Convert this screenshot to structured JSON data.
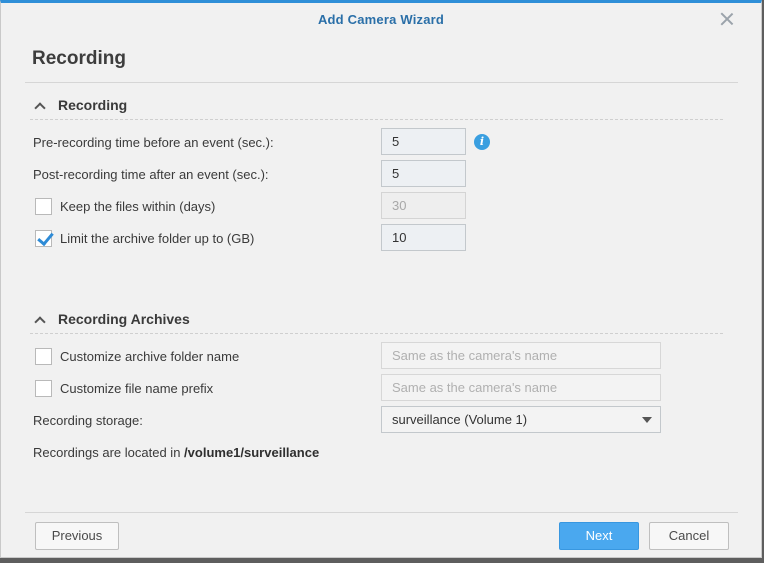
{
  "window": {
    "title": "Add Camera Wizard"
  },
  "page_title": "Recording",
  "sections": {
    "recording": {
      "heading": "Recording",
      "pre_recording": {
        "label": "Pre-recording time before an event (sec.):",
        "value": "5"
      },
      "post_recording": {
        "label": "Post-recording time after an event (sec.):",
        "value": "5"
      },
      "keep_files": {
        "label": "Keep the files within (days)",
        "checked": false,
        "value": "30"
      },
      "limit_archive": {
        "label": "Limit the archive folder up to (GB)",
        "checked": true,
        "value": "10"
      }
    },
    "archives": {
      "heading": "Recording Archives",
      "custom_folder": {
        "label": "Customize archive folder name",
        "checked": false,
        "placeholder": "Same as the camera's name"
      },
      "custom_prefix": {
        "label": "Customize file name prefix",
        "checked": false,
        "placeholder": "Same as the camera's name"
      },
      "storage": {
        "label": "Recording storage:",
        "selected": "surveillance (Volume 1)"
      },
      "location": {
        "prefix": "Recordings are located in",
        "path": "/volume1/surveillance"
      }
    }
  },
  "footer": {
    "previous": "Previous",
    "next": "Next",
    "cancel": "Cancel"
  },
  "icons": {
    "info": "i",
    "close": "close-icon",
    "collapse": "chevron-up-icon",
    "dropdown": "caret-down-icon"
  },
  "colors": {
    "accent": "#2f8fd8",
    "primary_button": "#4aa8ef",
    "title": "#2a6fa8"
  }
}
